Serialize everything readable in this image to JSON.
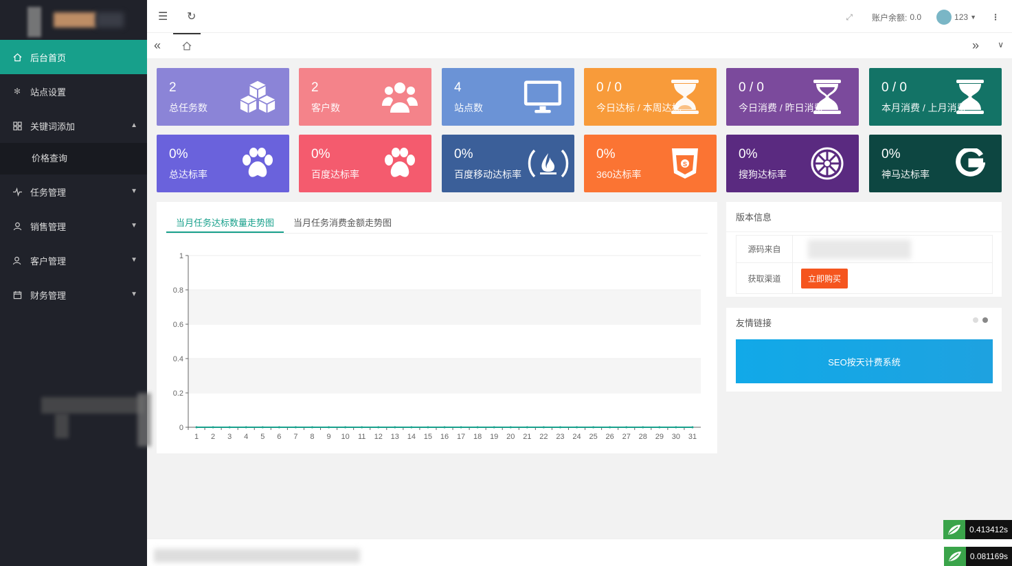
{
  "sidebar": {
    "items": [
      {
        "label": "后台首页",
        "icon": "home-icon"
      },
      {
        "label": "站点设置",
        "icon": "gear-icon"
      },
      {
        "label": "关键词添加",
        "icon": "grid-icon"
      },
      {
        "label": "价格查询"
      },
      {
        "label": "任务管理",
        "icon": "pulse-icon"
      },
      {
        "label": "销售管理",
        "icon": "user-icon"
      },
      {
        "label": "客户管理",
        "icon": "users-icon"
      },
      {
        "label": "财务管理",
        "icon": "calendar-icon"
      }
    ]
  },
  "header": {
    "balance_label": "账户余额:",
    "balance_value": "0.0",
    "username": "123"
  },
  "cards": [
    {
      "value": "2",
      "label": "总任务数",
      "color": "#8b84d7",
      "icon": "cubes-icon"
    },
    {
      "value": "2",
      "label": "客户数",
      "color": "#f4838a",
      "icon": "users-icon"
    },
    {
      "value": "4",
      "label": "站点数",
      "color": "#6b93d6",
      "icon": "monitor-icon"
    },
    {
      "value": "0 / 0",
      "label": "今日达标 / 本周达标",
      "color": "#f89b3a",
      "icon": "hourglass-icon"
    },
    {
      "value": "0 / 0",
      "label": "今日消费 / 昨日消费",
      "color": "#7b4a9c",
      "icon": "hourglass-icon"
    },
    {
      "value": "0 / 0",
      "label": "本月消费 / 上月消费",
      "color": "#137366",
      "icon": "hourglass-icon"
    },
    {
      "value": "0%",
      "label": "总达标率",
      "color": "#6a62dc",
      "icon": "paw-icon"
    },
    {
      "value": "0%",
      "label": "百度达标率",
      "color": "#f45b6e",
      "icon": "paw-icon"
    },
    {
      "value": "0%",
      "label": "百度移动达标率",
      "color": "#3b5f99",
      "icon": "flame-icon"
    },
    {
      "value": "0%",
      "label": "360达标率",
      "color": "#fb7433",
      "icon": "shield-icon"
    },
    {
      "value": "0%",
      "label": "搜狗达标率",
      "color": "#5a2a80",
      "icon": "empire-icon"
    },
    {
      "value": "0%",
      "label": "神马达标率",
      "color": "#0d4641",
      "icon": "google-icon"
    }
  ],
  "chart_tabs": [
    "当月任务达标数量走势图",
    "当月任务消费金额走势图"
  ],
  "chart_data": {
    "type": "line",
    "categories": [
      "1",
      "2",
      "3",
      "4",
      "5",
      "6",
      "7",
      "8",
      "9",
      "10",
      "11",
      "12",
      "13",
      "14",
      "15",
      "16",
      "17",
      "18",
      "19",
      "20",
      "21",
      "22",
      "23",
      "24",
      "25",
      "26",
      "27",
      "28",
      "29",
      "30",
      "31"
    ],
    "series": [
      {
        "values": [
          0,
          0,
          0,
          0,
          0,
          0,
          0,
          0,
          0,
          0,
          0,
          0,
          0,
          0,
          0,
          0,
          0,
          0,
          0,
          0,
          0,
          0,
          0,
          0,
          0,
          0,
          0,
          0,
          0,
          0,
          0
        ]
      }
    ],
    "ylim": [
      0,
      1
    ],
    "yticks": [
      "0",
      "0.2",
      "0.4",
      "0.6",
      "0.8",
      "1"
    ],
    "colors": {
      "line": "#17a08b",
      "band": "#f5f5f5"
    }
  },
  "version_panel": {
    "title": "版本信息",
    "rows": [
      {
        "label": "源码来自"
      },
      {
        "label": "获取渠道",
        "button": "立即购买"
      }
    ]
  },
  "links_panel": {
    "title": "友情链接",
    "banner": "SEO按天计费系统"
  },
  "timers": [
    "0.413412s",
    "0.081169s"
  ]
}
